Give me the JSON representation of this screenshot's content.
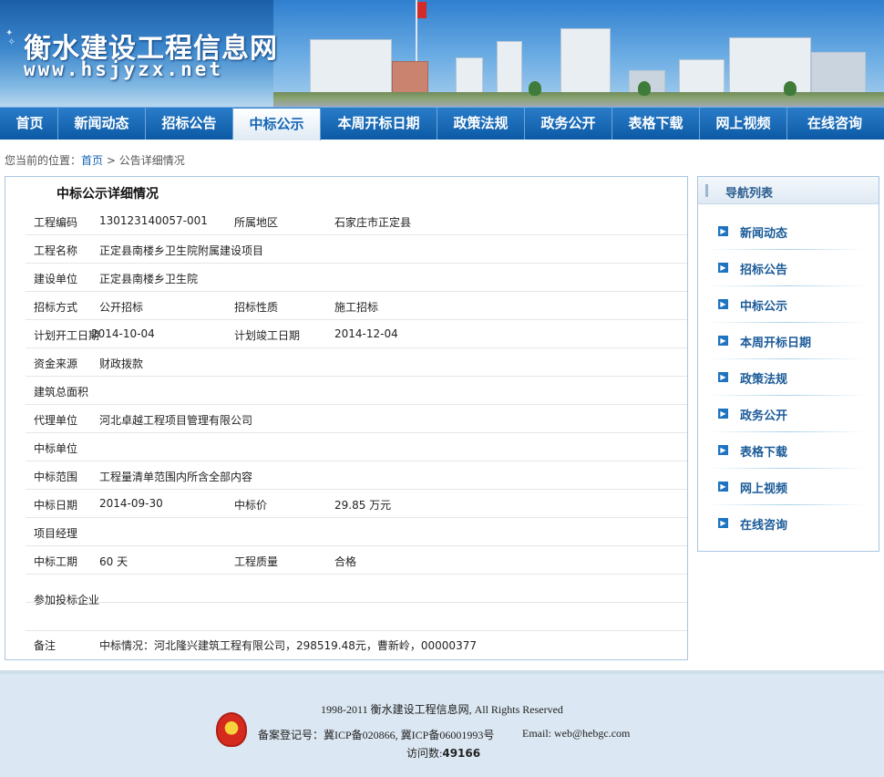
{
  "header": {
    "site_title": "衡水建设工程信息网",
    "site_url": "www.hsjyzx.net"
  },
  "nav": {
    "items": [
      {
        "label": "首页"
      },
      {
        "label": "新闻动态"
      },
      {
        "label": "招标公告"
      },
      {
        "label": "中标公示",
        "active": true
      },
      {
        "label": "本周开标日期"
      },
      {
        "label": "政策法规"
      },
      {
        "label": "政务公开"
      },
      {
        "label": "表格下载"
      },
      {
        "label": "网上视频"
      },
      {
        "label": "在线咨询"
      }
    ]
  },
  "breadcrumb": {
    "prefix": "您当前的位置：",
    "home": "首页",
    "current": " > 公告详细情况"
  },
  "detail": {
    "title": "中标公示详细情况",
    "rows": [
      {
        "l1": "工程编码",
        "v1": "130123140057-001",
        "l2": "所属地区",
        "v2": "石家庄市正定县"
      },
      {
        "l1": "工程名称",
        "v1": "正定县南楼乡卫生院附属建设项目",
        "l2": "",
        "v2": ""
      },
      {
        "l1": "建设单位",
        "v1": "正定县南楼乡卫生院",
        "l2": "",
        "v2": ""
      },
      {
        "l1": "招标方式",
        "v1": "公开招标",
        "l2": "招标性质",
        "v2": "施工招标"
      },
      {
        "l1": "计划开工日期",
        "v1": "2014-10-04",
        "l2": "计划竣工日期",
        "v2": "2014-12-04"
      },
      {
        "l1": "资金来源",
        "v1": "财政拨款",
        "l2": "",
        "v2": ""
      },
      {
        "l1": "建筑总面积",
        "v1": "",
        "l2": "",
        "v2": ""
      },
      {
        "l1": "代理单位",
        "v1": "河北卓越工程项目管理有限公司",
        "l2": "",
        "v2": ""
      },
      {
        "l1": "中标单位",
        "v1": "",
        "l2": "",
        "v2": ""
      },
      {
        "l1": "中标范围",
        "v1": "工程量清单范围内所含全部内容",
        "l2": "",
        "v2": ""
      },
      {
        "l1": "中标日期",
        "v1": "2014-09-30",
        "l2": "中标价",
        "v2": "29.85 万元"
      },
      {
        "l1": "项目经理",
        "v1": "",
        "l2": "",
        "v2": ""
      },
      {
        "l1": "中标工期",
        "v1": "60 天",
        "l2": "工程质量",
        "v2": "合格"
      }
    ],
    "bidders_label": "参加投标企业",
    "remark_label": "备注",
    "remark_value": "中标情况：河北隆兴建筑工程有限公司，298519.48元，曹新岭，00000377"
  },
  "sidebar": {
    "title": "导航列表",
    "items": [
      {
        "label": "新闻动态"
      },
      {
        "label": "招标公告"
      },
      {
        "label": "中标公示"
      },
      {
        "label": "本周开标日期"
      },
      {
        "label": "政策法规"
      },
      {
        "label": "政务公开"
      },
      {
        "label": "表格下载"
      },
      {
        "label": "网上视频"
      },
      {
        "label": "在线咨询"
      }
    ]
  },
  "footer": {
    "copyright": "1998-2011 衡水建设工程信息网, All Rights Reserved",
    "registration": "备案登记号：冀ICP备020866, 冀ICP备06001993号",
    "email": "Email: web@hebgc.com",
    "visits_label": "访问数:",
    "visits_count": "49166"
  },
  "colors": {
    "nav_bg": "#0c5aa6",
    "link": "#1565b6",
    "footer_bg": "#dbe7f2"
  }
}
